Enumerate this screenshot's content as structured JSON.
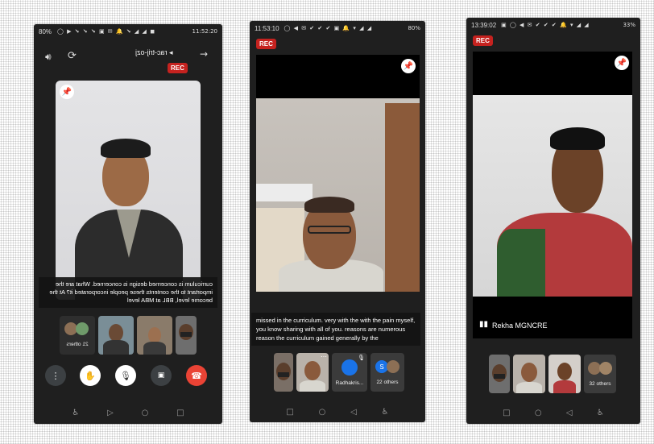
{
  "phone1": {
    "status_time": "11:52:20",
    "status_battery": "80%",
    "status_icons": "◼ ◣ ◣ ✔ 🔔 ✉ ▣ ✔ ✔ ✔ ◀ ◯",
    "meeting_code": "rac-trij-ozj",
    "rec_label": "REC",
    "caption": "curriculum is concerned design is concerned. What are the important to the contents these people incorporated it? At the become level, BBL at MBA level",
    "others_label": "21 others"
  },
  "phone2": {
    "status_time": "11:53:10",
    "status_battery": "80%",
    "status_icons": "◯ ◀ ✉ ✔ ✔ ✔ ▣ 🔔 ▾ ◢ ◢",
    "rec_label": "REC",
    "caption": "missed in the curriculum. very with the with the pain myself, you know sharing with all of you. reasons are numerous reason the curriculum gained generally by the",
    "participant_name": "Radhakris...",
    "avatar_letter": "S",
    "others_label": "22 others"
  },
  "phone3": {
    "status_time": "13:39:02",
    "status_battery": "33%",
    "status_icons": "▣ ◯ ◀ ✉ ✔ ✔ ✔ 🔔 ▾ ◢ ◢",
    "rec_label": "REC",
    "speaker_name": "Rekha MGNCRE",
    "others_label": "32 others"
  },
  "colors": {
    "rec_red": "#c5221f",
    "end_call_red": "#ea4335",
    "pin_blue": "#1a73e8",
    "phone_bg": "#1f1f1f"
  }
}
